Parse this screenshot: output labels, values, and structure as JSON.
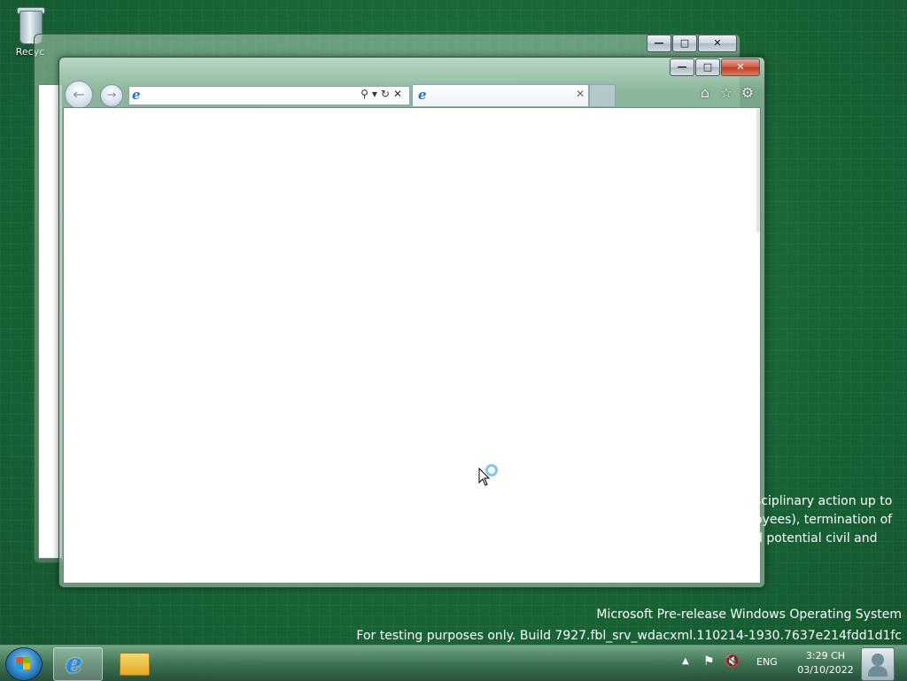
{
  "desktop": {
    "recycle_bin_label": "Recyc",
    "policy_lines": [
      "sciplinary action up to",
      "oyees), termination of",
      "d potential civil and"
    ],
    "build_line1": "Microsoft Pre-release Windows Operating System",
    "build_line2": "For testing purposes only. Build 7927.fbl_srv_wdacxml.110214-1930.7637e214fdd1d1fc"
  },
  "back_window": {
    "minimize": "—",
    "maximize": "□",
    "close": "✕"
  },
  "browser": {
    "minimize": "—",
    "maximize": "□",
    "close": "✕",
    "back_icon": "←",
    "forward_icon": "→",
    "address_value": "",
    "address_tools": "⚲▾↻✕",
    "tab_title": "",
    "tab_close": "✕",
    "home_icon": "⌂",
    "favorites_icon": "☆",
    "tools_icon": "⚙"
  },
  "taskbar": {
    "tray_up": "▲",
    "tray_flag": "⚑",
    "tray_volume": "🔇",
    "language": "ENG",
    "time": "3:29 CH",
    "date": "03/10/2022"
  }
}
